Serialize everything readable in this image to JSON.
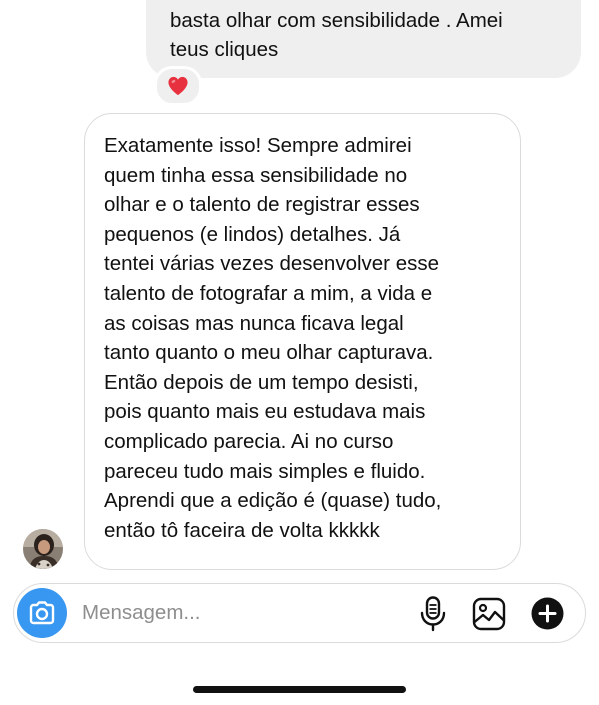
{
  "thread": {
    "sent_message": {
      "lines": [
        "basta olhar com sensibilidade . Amei",
        "teus cliques"
      ],
      "reaction": "heart-emoji"
    },
    "received_message": {
      "lines": [
        "Exatamente isso! Sempre admirei",
        "quem tinha essa sensibilidade no",
        "olhar e o talento de registrar esses",
        "pequenos (e lindos) detalhes. Já",
        "tentei várias vezes desenvolver esse",
        "talento de fotografar a mim, a vida e",
        "as coisas mas nunca ficava legal",
        "tanto quanto o meu olhar capturava.",
        "Então depois de um tempo desisti,",
        "pois quanto mais eu estudava mais",
        "complicado parecia. Ai no curso",
        "pareceu tudo mais simples e fluido.",
        "Aprendi que a edição é (quase) tudo,",
        "então tô faceira de volta kkkkk"
      ]
    }
  },
  "composer": {
    "placeholder": "Mensagem...",
    "value": "",
    "icons": {
      "camera": "camera-icon",
      "mic": "microphone-icon",
      "gallery": "gallery-icon",
      "plus": "plus-icon"
    }
  },
  "colors": {
    "accent": "#3897f0",
    "sent_bubble": "#efefef",
    "border": "#dbdbdb",
    "heart": "#e8313f",
    "placeholder": "#8e8e8e",
    "text": "#111111"
  }
}
